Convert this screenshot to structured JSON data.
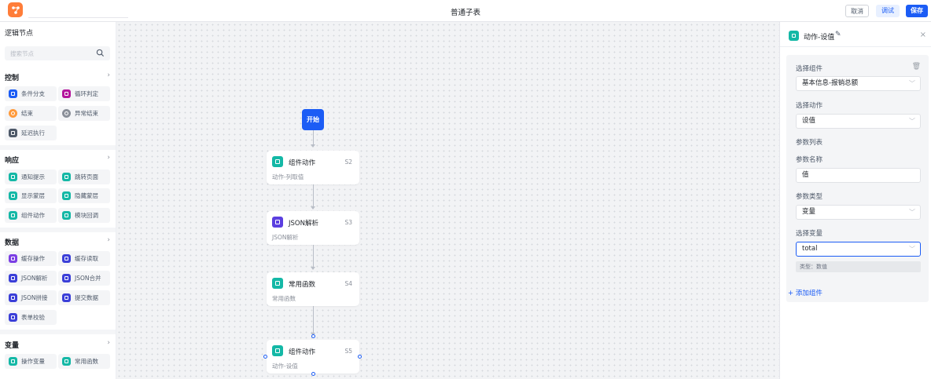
{
  "header": {
    "title": "普通子表",
    "cancel_label": "取消",
    "debug_label": "调试",
    "save_label": "保存",
    "brand_color": "#ff7d39",
    "accent_color": "#1b5cf5"
  },
  "sidebar": {
    "title": "逻辑节点",
    "search_placeholder": "搜索节点",
    "sections": [
      {
        "label": "控制",
        "items": [
          {
            "label": "条件分支",
            "color": "#1b5cf5",
            "icon": "branch-icon"
          },
          {
            "label": "循环判定",
            "color": "#b4169c",
            "icon": "loop-icon"
          },
          {
            "label": "结束",
            "color": "#ff9a3c",
            "icon": "end-icon"
          },
          {
            "label": "异常结束",
            "color": "#8a8f99",
            "icon": "error-end-icon"
          },
          {
            "label": "延迟执行",
            "color": "#4e5969",
            "icon": "delay-icon"
          }
        ]
      },
      {
        "label": "响应",
        "items": [
          {
            "label": "通知提示",
            "color": "#14b8a6",
            "icon": "notify-icon"
          },
          {
            "label": "跳转页面",
            "color": "#14b8a6",
            "icon": "jump-page-icon"
          },
          {
            "label": "显示蒙层",
            "color": "#14b8a6",
            "icon": "show-mask-icon"
          },
          {
            "label": "隐藏蒙层",
            "color": "#14b8a6",
            "icon": "hide-mask-icon"
          },
          {
            "label": "组件动作",
            "color": "#14b8a6",
            "icon": "component-action-icon"
          },
          {
            "label": "模块回调",
            "color": "#14b8a6",
            "icon": "module-callback-icon"
          }
        ]
      },
      {
        "label": "数据",
        "items": [
          {
            "label": "缓存操作",
            "color": "#7b3fe4",
            "icon": "cache-op-icon"
          },
          {
            "label": "缓存读取",
            "color": "#3b3fd8",
            "icon": "cache-read-icon"
          },
          {
            "label": "JSON解析",
            "color": "#3b3fd8",
            "icon": "json-parse-icon"
          },
          {
            "label": "JSON合并",
            "color": "#3b3fd8",
            "icon": "json-merge-icon"
          },
          {
            "label": "JSON拼接",
            "color": "#3b3fd8",
            "icon": "json-concat-icon"
          },
          {
            "label": "提交数据",
            "color": "#3b3fd8",
            "icon": "submit-data-icon"
          },
          {
            "label": "表单校验",
            "color": "#3b3fd8",
            "icon": "form-validate-icon"
          }
        ]
      },
      {
        "label": "变量",
        "items": [
          {
            "label": "操作变量",
            "color": "#14b8a6",
            "icon": "variable-icon"
          },
          {
            "label": "常用函数",
            "color": "#14b8a6",
            "icon": "function-icon"
          }
        ]
      }
    ]
  },
  "canvas": {
    "start_label": "开始",
    "nodes": [
      {
        "title": "组件动作",
        "id": "S2",
        "subtitle": "动作-列取值",
        "color": "#14b8a6"
      },
      {
        "title": "JSON解析",
        "id": "S3",
        "subtitle": "JSON解析",
        "color": "#5b3fe0"
      },
      {
        "title": "常用函数",
        "id": "S4",
        "subtitle": "常用函数",
        "color": "#14b8a6"
      },
      {
        "title": "组件动作",
        "id": "S5",
        "subtitle": "动作-设值",
        "color": "#14b8a6"
      }
    ]
  },
  "panel": {
    "title": "动作-设值",
    "select_component_label": "选择组件",
    "select_component_value": "基本信息-报销总额",
    "select_action_label": "选择动作",
    "select_action_value": "设值",
    "param_list_label": "参数列表",
    "param_name_label": "参数名称",
    "param_name_value": "值",
    "param_type_label": "参数类型",
    "param_type_value": "变量",
    "select_var_label": "选择变量",
    "select_var_value": "total",
    "type_hint": "类型：数值",
    "add_component_label": "添加组件"
  }
}
